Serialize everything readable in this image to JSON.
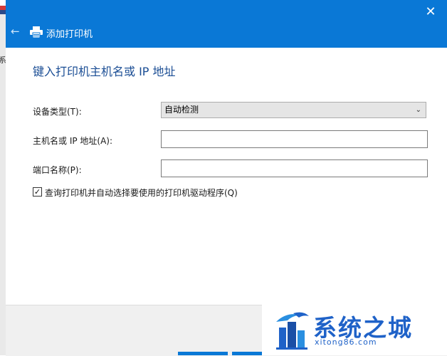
{
  "background": {
    "left_fragment": "系"
  },
  "titlebar": {
    "title": "添加打印机",
    "close_glyph": "✕",
    "back_glyph": "←"
  },
  "content": {
    "heading": "键入打印机主机名或 IP 地址",
    "fields": {
      "device_type_label": "设备类型(T):",
      "device_type_value": "自动检测",
      "host_label": "主机名或 IP 地址(A):",
      "host_value": "",
      "port_label": "端口名称(P):",
      "port_value": ""
    },
    "checkbox": {
      "checked": true,
      "label": "查询打印机并自动选择要使用的打印机驱动程序(Q)"
    }
  },
  "watermark": {
    "brand": "系统之城",
    "url": "xitong86.com"
  },
  "colors": {
    "titlebar": "#0a78d6",
    "heading": "#1a4d94",
    "watermark": "#1f62c8"
  }
}
